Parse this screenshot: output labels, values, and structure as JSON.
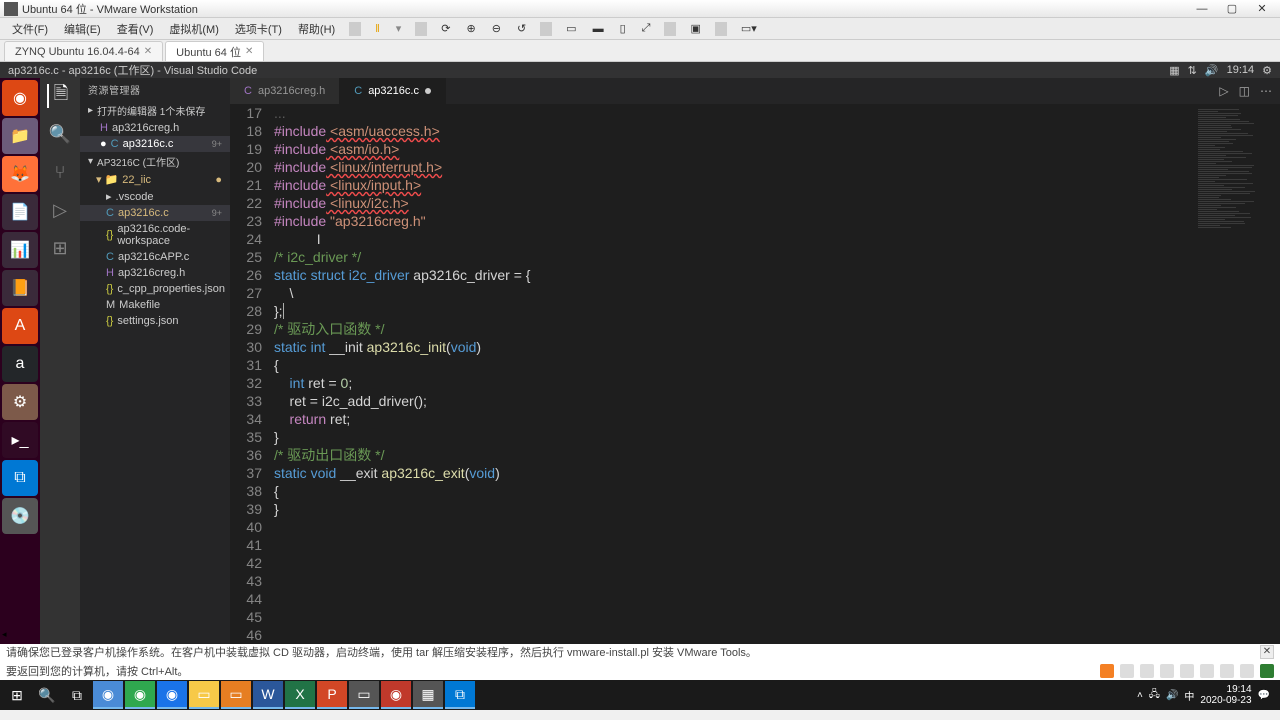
{
  "window": {
    "title": "Ubuntu 64 位 - VMware Workstation",
    "min": "—",
    "max": "▢",
    "close": "✕"
  },
  "menu": {
    "file": "文件(F)",
    "edit": "编辑(E)",
    "view": "查看(V)",
    "vm": "虚拟机(M)",
    "tabs": "选项卡(T)",
    "help": "帮助(H)"
  },
  "vm_tabs": {
    "tab1": "ZYNQ Ubuntu 16.04.4-64",
    "tab2": "Ubuntu 64 位"
  },
  "vscode": {
    "title": "ap3216c.c - ap3216c (工作区) - Visual Studio Code",
    "time": "19:14",
    "explorer_title": "资源管理器",
    "open_editors": "打开的编辑器   1个未保存",
    "workspace": "AP3216C (工作区)",
    "tabs": {
      "t1": "ap3216creg.h",
      "t2": "ap3216c.c"
    }
  },
  "sidebar": {
    "files": {
      "f0": "ap3216creg.h",
      "f1": "ap3216c.c",
      "folder1": "22_iic",
      "vscode_folder": ".vscode",
      "f2": "ap3216c.c",
      "f3": "ap3216c.code-workspace",
      "f4": "ap3216cAPP.c",
      "f5": "ap3216creg.h",
      "f6": "c_cpp_properties.json",
      "f7": "Makefile",
      "f8": "settings.json",
      "i1": "9+",
      "i2": "9+"
    }
  },
  "code": {
    "lines": [
      17,
      18,
      19,
      20,
      21,
      22,
      23,
      24,
      25,
      26,
      27,
      28,
      29,
      30,
      31,
      32,
      33,
      34,
      35,
      36,
      37,
      38,
      39,
      40,
      41,
      42,
      43,
      44,
      45,
      46
    ],
    "l18a": "#include",
    "l18b": " <asm/uaccess.h>",
    "l19a": "#include",
    "l19b": " <asm/io.h>",
    "l20a": "#include",
    "l20b": " <linux/interrupt.h>",
    "l21a": "#include",
    "l21b": " <linux/input.h>",
    "l22a": "#include",
    "l22b": " <linux/i2c.h>",
    "l23a": "#include",
    "l23b": " \"ap3216creg.h\"",
    "l24": "           I",
    "l25": "/* i2c_driver */",
    "l26a": "static",
    "l26b": " struct",
    "l26c": " i2c_driver",
    "l26d": " ap3216c_driver = {",
    "l27": "",
    "l28": "    \\",
    "l29": "};",
    "l30": "/* 驱动入口函数 */",
    "l31a": "static",
    "l31b": " int",
    "l31c": " __init ",
    "l31d": "ap3216c_init",
    "l31e": "(",
    "l31f": "void",
    "l31g": ")",
    "l32": "{",
    "l33": "",
    "l34a": "    int",
    "l34b": " ret = ",
    "l34c": "0",
    "l34d": ";",
    "l35": "",
    "l36": "    ret = i2c_add_driver();",
    "l37": "",
    "l38a": "    return",
    "l38b": " ret;",
    "l39": "",
    "l40": "}",
    "l41": "",
    "l42": "/* 驱动出口函数 */",
    "l43a": "static",
    "l43b": " void",
    "l43c": " __exit ",
    "l43d": "ap3216c_exit",
    "l43e": "(",
    "l43f": "void",
    "l43g": ")",
    "l44": "{",
    "l45": "",
    "l46": "}"
  },
  "status": {
    "vm_tip": "请确保您已登录客户机操作系统。在客户机中装载虚拟 CD 驱动器，启动终端，使用 tar 解压缩安装程序，然后执行 vmware-install.pl 安装 VMware Tools。",
    "hint": "要返回到您的计算机，请按 Ctrl+Alt。"
  },
  "taskbar": {
    "time": "19:14",
    "date": "2020-09-23"
  }
}
